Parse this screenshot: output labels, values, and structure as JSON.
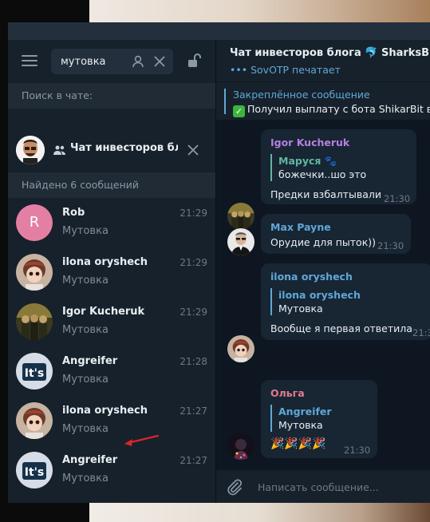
{
  "sidebar": {
    "search": {
      "value": "мутовка"
    },
    "search_in_chat_label": "Поиск в чате:",
    "chat_filter": {
      "title": "Чат инвесторов бл..."
    },
    "found_label": "Найдено 6 сообщений",
    "results": [
      {
        "name": "Rob",
        "time": "21:29",
        "text": "Мутовка",
        "avatar_letter": "R",
        "avatar_color": "#e47fa4"
      },
      {
        "name": "ilona oryshech",
        "time": "21:29",
        "text": "Мутовка"
      },
      {
        "name": "Igor Kucheruk",
        "time": "21:29",
        "text": "Мутовка"
      },
      {
        "name": "Angreifer",
        "time": "21:28",
        "text": "Мутовка"
      },
      {
        "name": "ilona oryshech",
        "time": "21:27",
        "text": "Мутовка"
      },
      {
        "name": "Angreifer",
        "time": "21:27",
        "text": "Мутовка"
      }
    ]
  },
  "chat": {
    "title": "Чат инвесторов блога 🐬 SharksBusine",
    "status": "SovOTP печатает",
    "pinned": {
      "title": "Закреплённое сообщение",
      "text": "Получил выплату с бота ShikarBit в р"
    },
    "messages": [
      {
        "author": "Igor Kucheruk",
        "author_color": "#b67fe0",
        "reply_name": "Маруся",
        "reply_color": "#5fb8a0",
        "reply_text": "божечки..шо это",
        "text": "Предки взбалтывали",
        "time": "21:30"
      },
      {
        "author": "Max Payne",
        "author_color": "#5fa8d8",
        "text": "Орудие для пыток))",
        "time": "21:30"
      },
      {
        "author": "ilona oryshech",
        "author_color": "#5fa8d8",
        "reply_name": "ilona oryshech",
        "reply_color": "#5fa8d8",
        "reply_text": "Мутовка",
        "text": "Вообще я первая ответила",
        "time": "21:3"
      },
      {
        "author": "Ольга",
        "author_color": "#e27a8f",
        "reply_name": "Angreifer",
        "reply_color": "#5fa8d8",
        "reply_text": "Мутовка",
        "text": "🎉🎉🎉🎉",
        "time": "21:30"
      }
    ],
    "composer_placeholder": "Написать сообщение..."
  },
  "colors": {
    "panel_bg": "#17212b",
    "chat_bg": "#0e1621",
    "bubble_bg": "#182533",
    "accent": "#5fa8d8",
    "arrow": "#d9262b"
  },
  "icons": [
    "menu-icon",
    "user-icon",
    "close-icon",
    "lock-open-icon",
    "people-icon",
    "paperclip-icon",
    "check-emoji",
    "arrow-annotation"
  ]
}
